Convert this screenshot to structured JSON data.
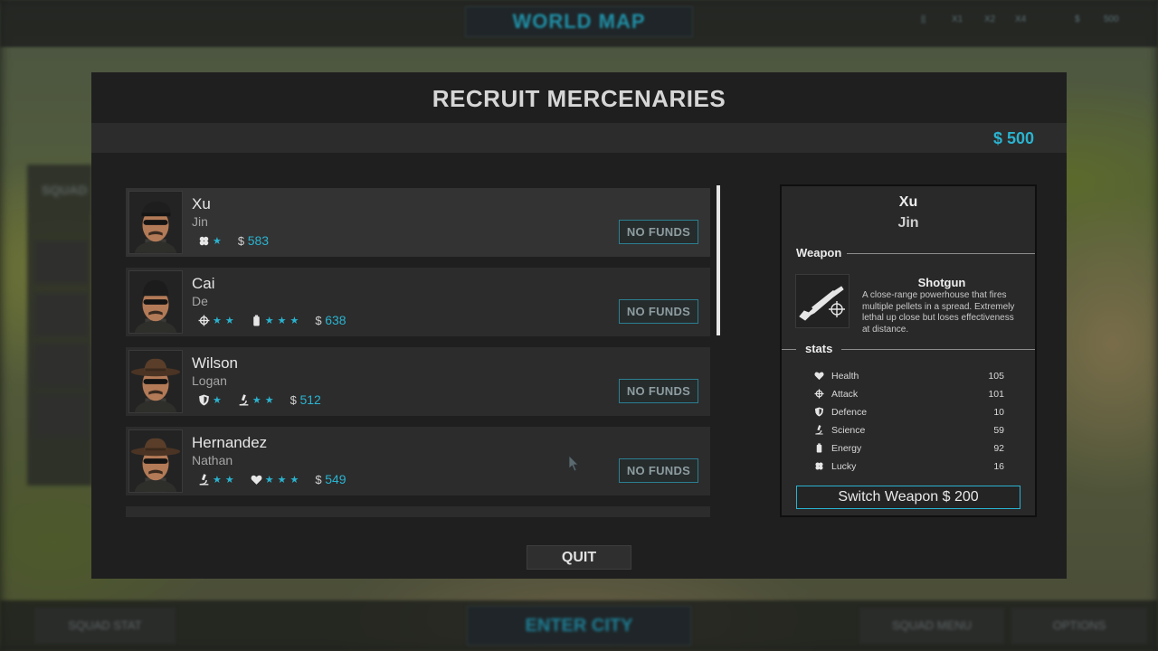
{
  "background": {
    "world_map_title": "WORLD MAP",
    "top_right": [
      "||",
      "X1",
      "X2",
      "X4",
      "$",
      "500"
    ],
    "left_panel_title": "SQUAD",
    "bottom": {
      "squad_stat": "SQUAD STAT",
      "enter_city": "ENTER CITY",
      "squad_menu": "SQUAD MENU",
      "options": "OPTIONS"
    }
  },
  "dialog": {
    "title": "RECRUIT MERCENARIES",
    "money": "$ 500",
    "quit_label": "QUIT",
    "mercenaries": [
      {
        "first": "Xu",
        "last": "Jin",
        "hat": "beret",
        "stats": [
          {
            "icon": "lucky-icon",
            "stars": 1
          }
        ],
        "cost_sign": "$",
        "cost": "583",
        "button": "NO FUNDS",
        "selected": true
      },
      {
        "first": "Cai",
        "last": "De",
        "hat": "beanie",
        "stats": [
          {
            "icon": "attack-icon",
            "stars": 2
          },
          {
            "icon": "energy-icon",
            "stars": 3
          }
        ],
        "cost_sign": "$",
        "cost": "638",
        "button": "NO FUNDS",
        "selected": false
      },
      {
        "first": "Wilson",
        "last": "Logan",
        "hat": "cowboy",
        "stats": [
          {
            "icon": "defence-icon",
            "stars": 1
          },
          {
            "icon": "science-icon",
            "stars": 2
          }
        ],
        "cost_sign": "$",
        "cost": "512",
        "button": "NO FUNDS",
        "selected": false
      },
      {
        "first": "Hernandez",
        "last": "Nathan",
        "hat": "cowboy",
        "stats": [
          {
            "icon": "science-icon",
            "stars": 2
          },
          {
            "icon": "health-icon",
            "stars": 3
          }
        ],
        "cost_sign": "$",
        "cost": "549",
        "button": "NO FUNDS",
        "selected": false
      }
    ]
  },
  "detail": {
    "first": "Xu",
    "last": "Jin",
    "weapon_header": "Weapon",
    "weapon_name": "Shotgun",
    "weapon_desc": "A close-range powerhouse that fires multiple pellets in a spread. Extremely lethal up close but loses effectiveness at distance.",
    "stats_header": "stats",
    "stats": [
      {
        "icon": "health-icon",
        "label": "Health",
        "value": "105"
      },
      {
        "icon": "attack-icon",
        "label": "Attack",
        "value": "101"
      },
      {
        "icon": "defence-icon",
        "label": "Defence",
        "value": "10"
      },
      {
        "icon": "science-icon",
        "label": "Science",
        "value": "59"
      },
      {
        "icon": "energy-icon",
        "label": "Energy",
        "value": "92"
      },
      {
        "icon": "lucky-icon",
        "label": "Lucky",
        "value": "16"
      }
    ],
    "switch_weapon": "Switch Weapon   $ 200"
  },
  "colors": {
    "accent": "#2ab3d0",
    "panel": "#1f1f1f",
    "card": "#2c2c2c"
  }
}
